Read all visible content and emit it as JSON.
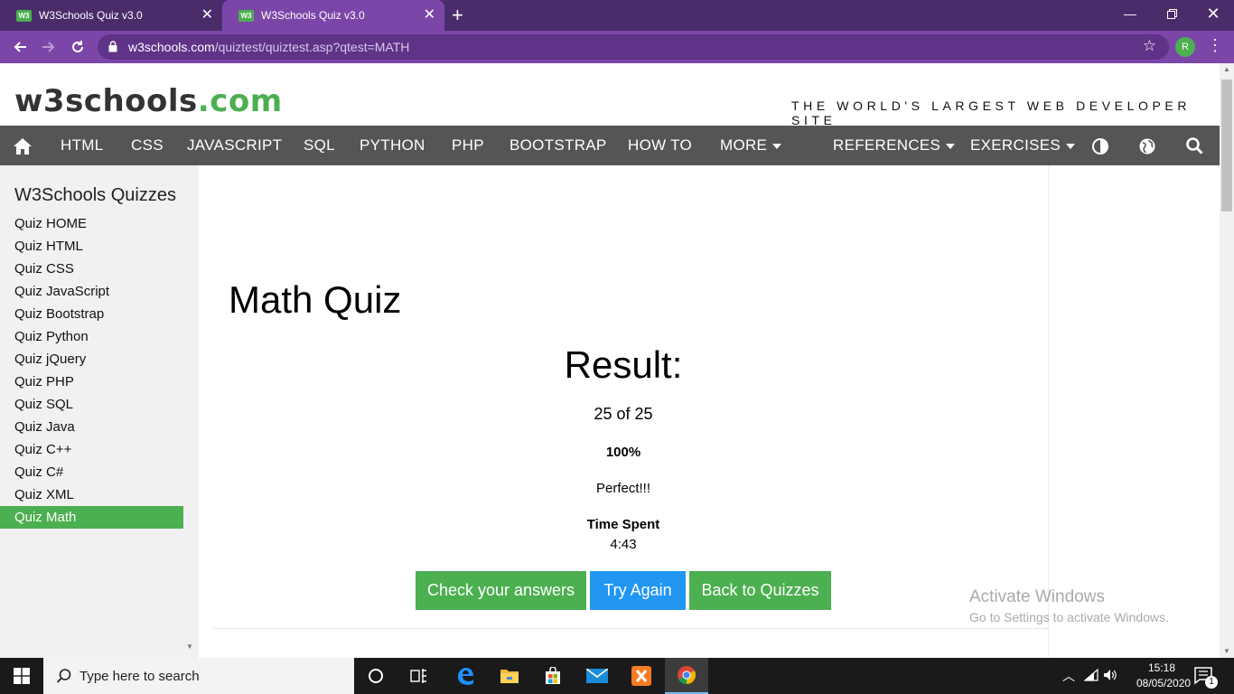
{
  "browser": {
    "tabs": [
      {
        "title": "W3Schools Quiz v3.0",
        "active": false
      },
      {
        "title": "W3Schools Quiz v3.0",
        "active": true
      }
    ],
    "favicon_text": "W3",
    "url_host": "w3schools.com",
    "url_path": "/quiztest/quiztest.asp?qtest=MATH",
    "profile_initial": "R"
  },
  "site": {
    "logo_main": "w3schools",
    "logo_suffix": ".com",
    "tagline": "THE WORLD'S LARGEST WEB DEVELOPER SITE",
    "nav": [
      "HTML",
      "CSS",
      "JAVASCRIPT",
      "SQL",
      "PYTHON",
      "PHP",
      "BOOTSTRAP",
      "HOW TO",
      "MORE",
      "REFERENCES",
      "EXERCISES"
    ]
  },
  "sidebar": {
    "title": "W3Schools Quizzes",
    "items": [
      "Quiz HOME",
      "Quiz HTML",
      "Quiz CSS",
      "Quiz JavaScript",
      "Quiz Bootstrap",
      "Quiz Python",
      "Quiz jQuery",
      "Quiz PHP",
      "Quiz SQL",
      "Quiz Java",
      "Quiz C++",
      "Quiz C#",
      "Quiz XML",
      "Quiz Math"
    ],
    "active": "Quiz Math"
  },
  "main": {
    "title": "Math Quiz",
    "result_label": "Result:",
    "score": "25 of 25",
    "percent": "100%",
    "message": "Perfect!!!",
    "time_label": "Time Spent",
    "time_value": "4:43",
    "buttons": {
      "check": "Check your answers",
      "try_again": "Try Again",
      "back": "Back to Quizzes"
    }
  },
  "watermark": {
    "title": "Activate Windows",
    "subtitle": "Go to Settings to activate Windows."
  },
  "taskbar": {
    "search_placeholder": "Type here to search",
    "time": "15:18",
    "date": "08/05/2020",
    "notification_count": "1"
  },
  "colors": {
    "chrome_dark": "#4a2c6b",
    "chrome": "#7c46a9",
    "w3_green": "#4caf50",
    "w3_blue": "#2196f3",
    "nav_bg": "#555555"
  }
}
